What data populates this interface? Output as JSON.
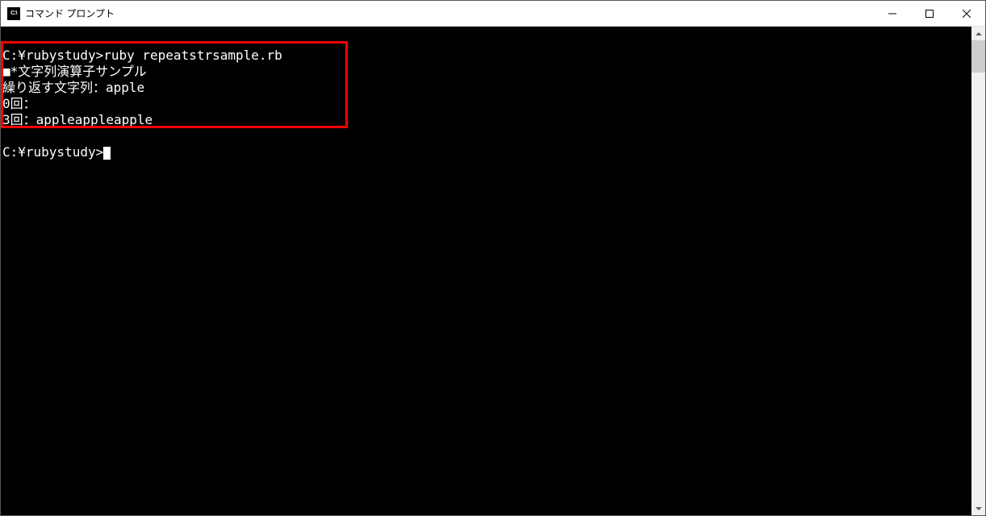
{
  "window": {
    "title": "コマンド プロンプト",
    "icon_text": "C:\\"
  },
  "terminal": {
    "lines": [
      "C:¥rubystudy>ruby repeatstrsample.rb",
      "■*文字列演算子サンプル",
      "繰り返す文字列：apple",
      "0回：",
      "3回：appleappleapple"
    ],
    "prompt": "C:¥rubystudy>"
  }
}
